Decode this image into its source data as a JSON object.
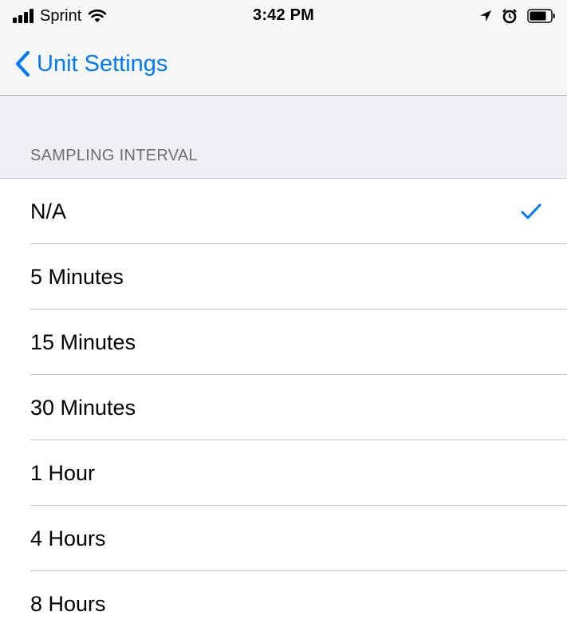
{
  "status_bar": {
    "carrier": "Sprint",
    "time": "3:42 PM",
    "icons": [
      "signal-icon",
      "wifi-icon",
      "location-arrow-icon",
      "alarm-icon",
      "battery-icon"
    ]
  },
  "nav_bar": {
    "back_label": "Unit Settings",
    "accent_color": "#007aff"
  },
  "section": {
    "header": "SAMPLING INTERVAL",
    "options": [
      {
        "label": "N/A",
        "selected": true
      },
      {
        "label": "5 Minutes",
        "selected": false
      },
      {
        "label": "15 Minutes",
        "selected": false
      },
      {
        "label": "30 Minutes",
        "selected": false
      },
      {
        "label": "1 Hour",
        "selected": false
      },
      {
        "label": "4 Hours",
        "selected": false
      },
      {
        "label": "8 Hours",
        "selected": false
      }
    ]
  }
}
